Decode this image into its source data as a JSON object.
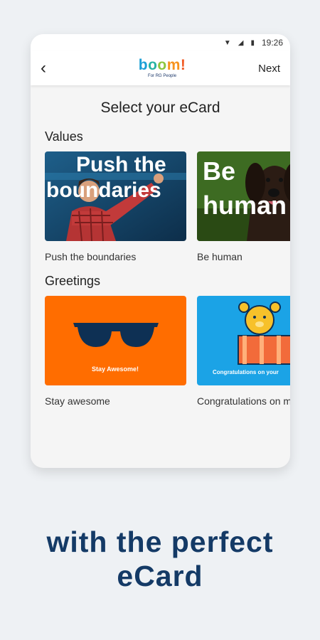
{
  "status_bar": {
    "time": "19:26"
  },
  "app_bar": {
    "back_label": "‹",
    "logo_letters": [
      "b",
      "o",
      "o",
      "m",
      "!"
    ],
    "logo_sub": "For RG People",
    "next_label": "Next"
  },
  "page": {
    "title": "Select your eCard",
    "sections": [
      {
        "heading": "Values",
        "cards": [
          {
            "label": "Push the boundaries",
            "overlay_text": "Push the boundaries"
          },
          {
            "label": "Be human",
            "overlay_text": "Be human"
          }
        ]
      },
      {
        "heading": "Greetings",
        "cards": [
          {
            "label": "Stay awesome",
            "overlay_text": "Stay Awesome!"
          },
          {
            "label": "Congratulations on mini me",
            "overlay_text": "Congratulations on your"
          }
        ]
      }
    ]
  },
  "tagline": {
    "line1": "with the perfect",
    "line2": "eCard"
  },
  "colors": {
    "tagline": "#143a66",
    "orange_card": "#ff6d00",
    "blue_card": "#1ba3e6"
  }
}
